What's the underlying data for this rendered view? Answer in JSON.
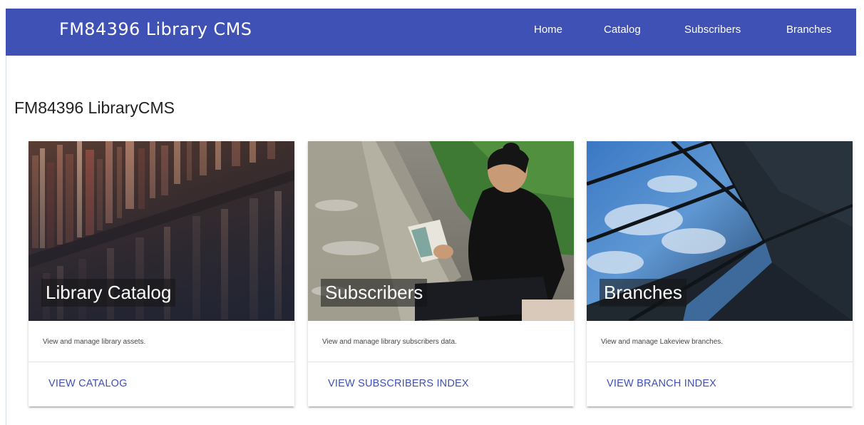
{
  "navbar": {
    "brand": "FM84396 Library CMS",
    "links": [
      {
        "label": "Home"
      },
      {
        "label": "Catalog"
      },
      {
        "label": "Subscribers"
      },
      {
        "label": "Branches"
      }
    ],
    "bg_color": "#3f51b5"
  },
  "page": {
    "title": "FM84396 LibraryCMS"
  },
  "cards": [
    {
      "title": "Library Catalog",
      "text": "View and manage library assets.",
      "action": "VIEW CATALOG",
      "image": "bookshelf-photo"
    },
    {
      "title": "Subscribers",
      "text": "View and manage library subscribers data.",
      "action": "VIEW SUBSCRIBERS INDEX",
      "image": "reader-sitting-photo"
    },
    {
      "title": "Branches",
      "text": "View and manage Lakeview branches.",
      "action": "VIEW BRANCH INDEX",
      "image": "glass-building-sky-photo"
    }
  ],
  "colors": {
    "accent": "#3f51b5",
    "text": "#222222"
  }
}
